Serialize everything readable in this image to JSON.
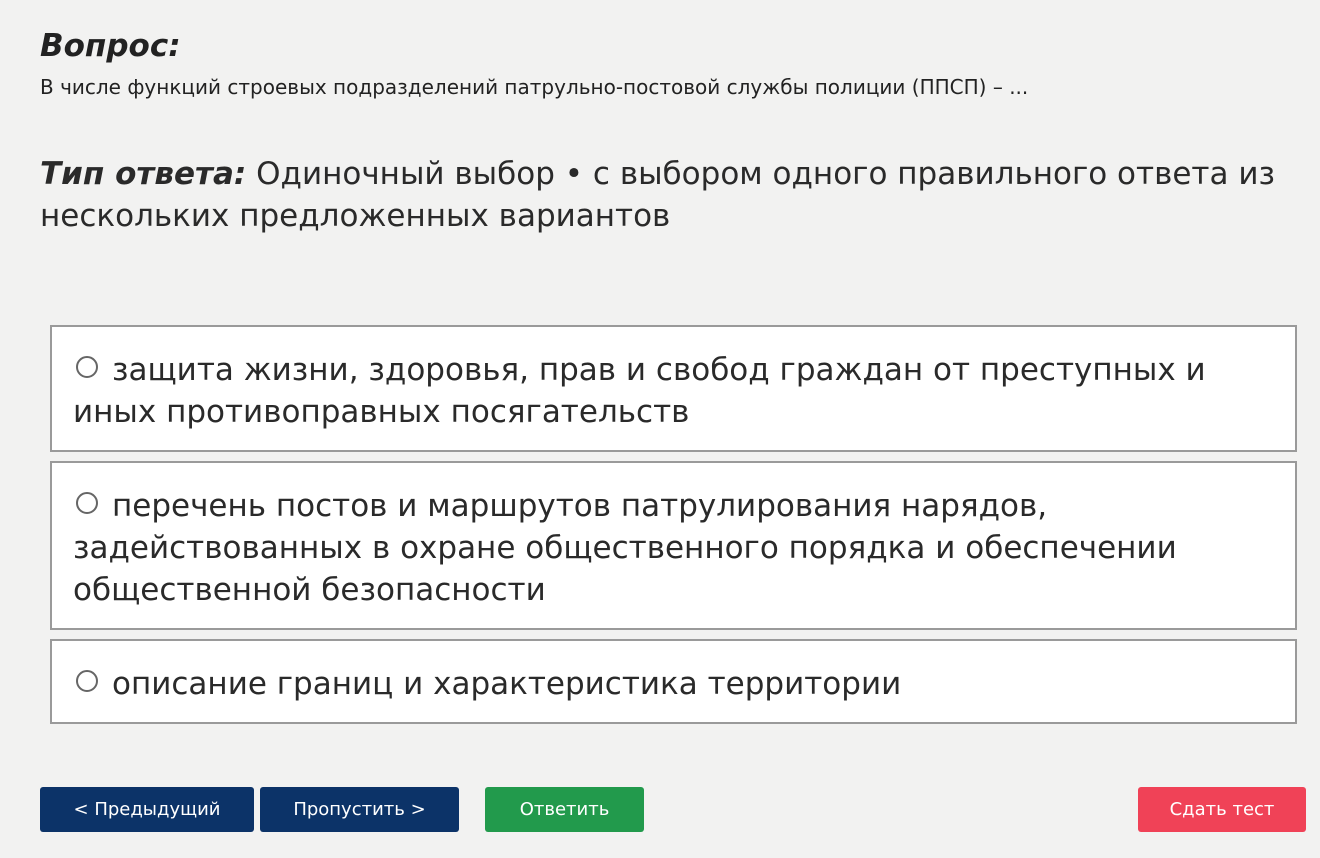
{
  "question": {
    "heading": "Вопрос:",
    "text": "В числе функций строевых подразделений патрульно-постовой службы полиции (ППСП) – ..."
  },
  "answer_type": {
    "label": "Тип ответа:",
    "value": "Одиночный выбор • с выбором одного правильного ответа из нескольких предложенных вариантов"
  },
  "options": [
    {
      "text": "защита жизни, здоровья, прав и свобод граждан от преступных и иных противоправных посягательств",
      "selected": false
    },
    {
      "text": "перечень постов и маршрутов патрулирования нарядов, задействованных в охране общественного порядка и обеспечении общественной безопасности",
      "selected": false
    },
    {
      "text": "описание границ и характеристика территории",
      "selected": false
    }
  ],
  "buttons": {
    "prev": "< Предыдущий",
    "skip": "Пропустить >",
    "answer": "Ответить",
    "submit": "Сдать тест"
  },
  "colors": {
    "nav_button": "#0c3368",
    "answer_button": "#229a4c",
    "submit_button": "#f04257",
    "background": "#f2f2f1"
  }
}
